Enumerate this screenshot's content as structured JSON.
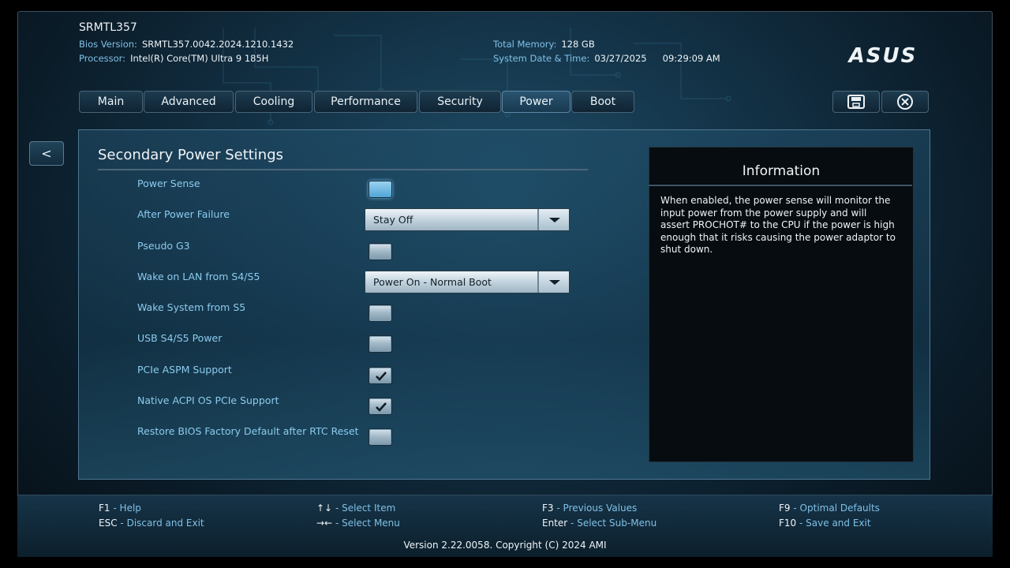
{
  "header": {
    "model": "SRMTL357",
    "bios_version_label": "Bios Version:",
    "bios_version": "SRMTL357.0042.2024.1210.1432",
    "processor_label": "Processor:",
    "processor": "Intel(R) Core(TM) Ultra 9 185H",
    "total_memory_label": "Total Memory:",
    "total_memory": "128 GB",
    "datetime_label": "System Date & Time:",
    "date": "03/27/2025",
    "time": "09:29:09 AM",
    "logo_text": "ASUS"
  },
  "tabs": [
    {
      "label": "Main"
    },
    {
      "label": "Advanced"
    },
    {
      "label": "Cooling"
    },
    {
      "label": "Performance"
    },
    {
      "label": "Security"
    },
    {
      "label": "Power",
      "active": true
    },
    {
      "label": "Boot"
    }
  ],
  "toolbar": {
    "save_icon": "save-icon",
    "exit_icon": "close-circle-icon"
  },
  "back_button": {
    "label": "<"
  },
  "section": {
    "title": "Secondary Power Settings"
  },
  "settings": [
    {
      "label": "Power Sense",
      "type": "checkbox",
      "checked": false,
      "focused": true
    },
    {
      "label": "After Power Failure",
      "type": "dropdown",
      "value": "Stay Off"
    },
    {
      "label": "Pseudo G3",
      "type": "checkbox",
      "checked": false
    },
    {
      "label": "Wake on LAN from S4/S5",
      "type": "dropdown",
      "value": "Power On - Normal Boot"
    },
    {
      "label": "Wake System from S5",
      "type": "checkbox",
      "checked": false
    },
    {
      "label": "USB S4/S5 Power",
      "type": "checkbox",
      "checked": false
    },
    {
      "label": "PCIe ASPM Support",
      "type": "checkbox",
      "checked": true
    },
    {
      "label": "Native ACPI OS PCIe Support",
      "type": "checkbox",
      "checked": true
    },
    {
      "label": "Restore BIOS Factory Default after RTC Reset",
      "type": "checkbox",
      "checked": false
    }
  ],
  "information": {
    "title": "Information",
    "text": "When enabled, the power sense will monitor the input power from the power supply and will assert PROCHOT# to the CPU if the power is high enough that it risks causing the power adaptor to shut down."
  },
  "footer": {
    "hints": [
      {
        "key": "F1",
        "desc": "Help"
      },
      {
        "key": "ESC",
        "desc": "Discard and Exit"
      },
      {
        "key": "↑↓",
        "desc": "Select Item"
      },
      {
        "key": "→←",
        "desc": "Select Menu"
      },
      {
        "key": "F3",
        "desc": "Previous Values"
      },
      {
        "key": "Enter",
        "desc": "Select Sub-Menu"
      },
      {
        "key": "F9",
        "desc": "Optimal Defaults"
      },
      {
        "key": "F10",
        "desc": "Save and Exit"
      }
    ],
    "separator": "-",
    "version": "Version 2.22.0058. Copyright (C) 2024 AMI"
  },
  "colors": {
    "accent": "#7fc0e6",
    "label": "#8ccbee",
    "panel_bg": "#143449"
  }
}
